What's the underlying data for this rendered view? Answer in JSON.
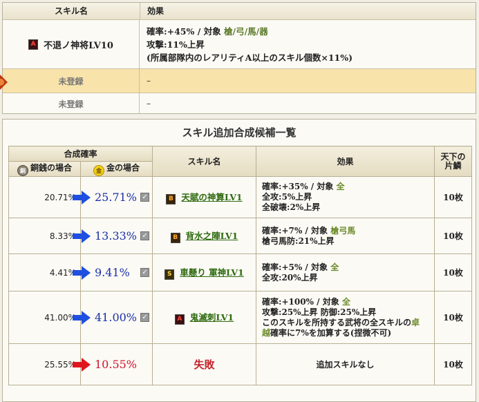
{
  "top": {
    "col_skill": "スキル名",
    "col_effect": "効果",
    "skill": {
      "rank": "A",
      "name": "不退ノ神将LV10",
      "effect_line1_prefix": "確率:+45% / 対象",
      "effect_line1_target": "槍/弓/馬/器",
      "effect_line2": "攻撃:11%上昇",
      "effect_line3": "(所属部隊内のレアリティA以上のスキル個数×11%)"
    },
    "slots": [
      {
        "name": "未登録",
        "effect": "–"
      },
      {
        "name": "未登録",
        "effect": "–"
      }
    ]
  },
  "candidates": {
    "title": "スキル追加合成候補一覧",
    "headers": {
      "rate": "合成確率",
      "copper": "銅銭の場合",
      "gold": "金の場合",
      "copper_icon": "銅",
      "gold_icon": "金",
      "skill": "スキル名",
      "effect": "効果",
      "count_line1": "天下の",
      "count_line2": "片鱗"
    },
    "rows": [
      {
        "base": "20.71%",
        "gold": "25.71%",
        "rank": "B",
        "skill": "天賦の神算LV1",
        "eff1_prefix": "確率:+35% / 対象",
        "eff1_target": "全",
        "eff2": "全攻:5%上昇",
        "eff3": "全破壊:2%上昇",
        "eff4": "",
        "count": "10枚"
      },
      {
        "base": "8.33%",
        "gold": "13.33%",
        "rank": "B",
        "skill": "背水之陣LV1",
        "eff1_prefix": "確率:+7% / 対象",
        "eff1_target": "槍弓馬",
        "eff2": "槍弓馬防:21%上昇",
        "eff3": "",
        "eff4": "",
        "count": "10枚"
      },
      {
        "base": "4.41%",
        "gold": "9.41%",
        "rank": "S",
        "skill": "車懸り 軍神LV1",
        "eff1_prefix": "確率:+5% / 対象",
        "eff1_target": "全",
        "eff2": "全攻:20%上昇",
        "eff3": "",
        "eff4": "",
        "count": "10枚"
      },
      {
        "base": "41.00%",
        "gold": "41.00%",
        "rank": "A",
        "skill": "鬼滅刺LV1",
        "eff1_prefix": "確率:+100% / 対象",
        "eff1_target": "全",
        "eff2": "攻撃:25%上昇 防御:25%上昇",
        "eff3_a": "このスキルを所持する武将の全スキルの",
        "eff3_b": "卓",
        "eff4_a": "越",
        "eff4_b": "確率に7%を加算する(捏微不可)",
        "count": "10枚"
      },
      {
        "base": "25.55%",
        "gold": "10.55%",
        "skill": "失敗",
        "effect": "追加スキルなし",
        "count": "10枚"
      }
    ]
  },
  "colors": {
    "arrow_blue": "#1f4fe0",
    "arrow_red": "#e0161e",
    "highlight_row": "#f8e3ab",
    "link_green": "#2f6b10"
  }
}
